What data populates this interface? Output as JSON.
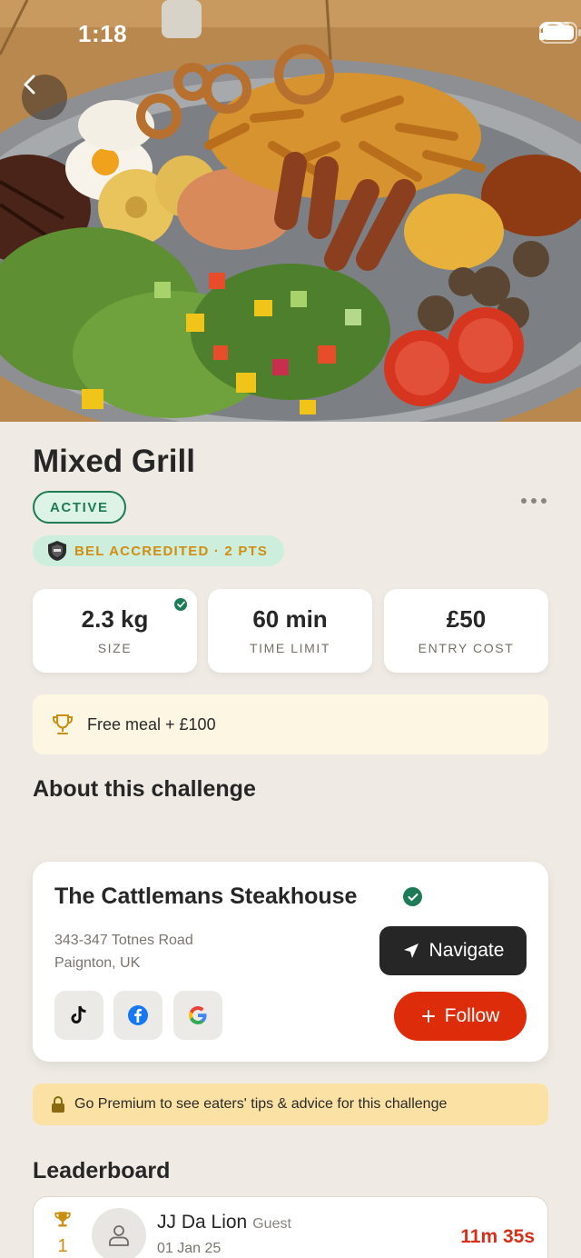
{
  "status_bar": {
    "time": "1:18"
  },
  "challenge": {
    "title": "Mixed Grill",
    "status_badge": "ACTIVE",
    "accreditation": "BEL ACCREDITED · 2 PTS"
  },
  "stats": [
    {
      "value": "2.3 kg",
      "label": "SIZE"
    },
    {
      "value": "60 min",
      "label": "TIME LIMIT"
    },
    {
      "value": "£50",
      "label": "ENTRY COST"
    }
  ],
  "prize": "Free meal + £100",
  "about_heading": "About this challenge",
  "venue": {
    "name": "The Cattlemans Steakhouse",
    "address_line1": "343-347 Totnes Road",
    "address_line2": "Paignton, UK",
    "navigate_label": "Navigate",
    "follow_label": "Follow"
  },
  "premium_notice": "Go Premium to see eaters' tips & advice for this challenge",
  "leaderboard": {
    "heading": "Leaderboard",
    "entries": [
      {
        "rank": "1",
        "name": "JJ Da Lion",
        "tag": "Guest",
        "date": "01 Jan 25",
        "time": "11m 35s"
      }
    ]
  },
  "colors": {
    "accent_green": "#1f7a56",
    "follow_red": "#dd2c0a",
    "time_red": "#d6301a",
    "gold": "#c98f10",
    "background": "#efebe4"
  },
  "icons": [
    "chevron-left-icon",
    "trophy-icon",
    "verified-check-icon",
    "navigate-arrow-icon",
    "tiktok-icon",
    "facebook-icon",
    "google-icon",
    "lock-icon",
    "user-icon",
    "more-icon"
  ]
}
